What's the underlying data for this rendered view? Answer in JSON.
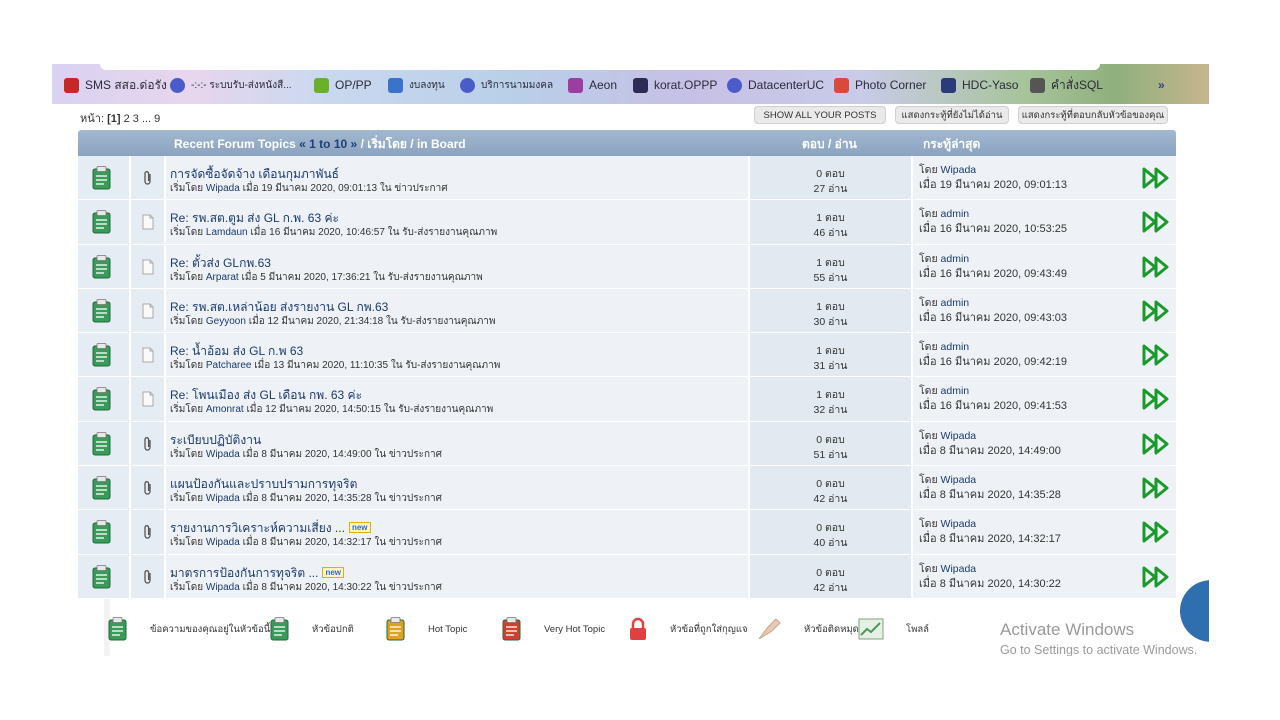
{
  "bookmarks": [
    {
      "label": "SMS สสอ.ด่อรัง",
      "icon": "bookmark-red-icon",
      "color": "#c62828"
    },
    {
      "label": "-:-:- ระบบรับ-ส่งหนังสื...",
      "icon": "globe-icon",
      "color": "#4a5cc9"
    },
    {
      "label": "OP/PP",
      "icon": "op-logo-icon",
      "color": "#6bb02b"
    },
    {
      "label": "งบลงทุน",
      "icon": "network-icon",
      "color": "#3a73c9"
    },
    {
      "label": "บริการนามมงคล",
      "icon": "globe-icon",
      "color": "#4a5cc9"
    },
    {
      "label": "Aeon",
      "icon": "aeon-icon",
      "color": "#9c3ea0"
    },
    {
      "label": "korat.OPPP",
      "icon": "b-logo-icon",
      "color": "#2b2b55"
    },
    {
      "label": "DatacenterUC",
      "icon": "globe-icon",
      "color": "#4a5cc9"
    },
    {
      "label": "Photo Corner",
      "icon": "photo-icon",
      "color": "#d84a3a"
    },
    {
      "label": "HDC-Yaso",
      "icon": "hdc-icon",
      "color": "#2a3a7a"
    },
    {
      "label": "คำสั่งSQL",
      "icon": "folder-icon",
      "color": "#555555"
    }
  ],
  "bookmarks_more": "»",
  "pager": {
    "label": "หน้า:",
    "current": "[1]",
    "rest": "2 3 ... 9"
  },
  "top_buttons": {
    "show_all": "SHOW ALL YOUR POSTS",
    "unread": "แสดงกระทู้ที่ยังไม่ได้อ่าน",
    "replies": "แสดงกระทู้ที่ตอบกลับหัวข้อของคุณ"
  },
  "header": {
    "title": "Recent Forum Topics",
    "range_open": "«",
    "range": "1 to 10",
    "range_close": "»",
    "rest": "/ เริ่มโดย / in Board",
    "replies_views": "ตอบ / อ่าน",
    "last_post": "กระทู้ล่าสุด"
  },
  "labels": {
    "started_by": "เริ่มโดย",
    "on": "เมื่อ",
    "in": "ใน",
    "by": "โดย",
    "new": "new"
  },
  "topics": [
    {
      "title": "การจัดซื้อจัดจ้าง เดือนกุมภาพันธ์",
      "new": false,
      "attachment": true,
      "author": "Wipada",
      "date": "19 มีนาคม 2020, 09:01:13",
      "board": "ข่าวประกาศ",
      "replies": "0 ตอบ",
      "views": "27 อ่าน",
      "last_by": "Wipada",
      "last_date": "19 มีนาคม 2020, 09:01:13"
    },
    {
      "title": "Re: รพ.สต.ตูม ส่ง GL ก.พ. 63 ค่ะ",
      "new": false,
      "attachment": false,
      "author": "Lamdaun",
      "date": "16 มีนาคม 2020, 10:46:57",
      "board": "รับ-ส่งรายงานคุณภาพ",
      "replies": "1 ตอบ",
      "views": "46 อ่าน",
      "last_by": "admin",
      "last_date": "16 มีนาคม 2020, 10:53:25"
    },
    {
      "title": "Re: ตั้วส่ง GLกพ.63",
      "new": false,
      "attachment": false,
      "author": "Arparat",
      "date": "5 มีนาคม 2020, 17:36:21",
      "board": "รับ-ส่งรายงานคุณภาพ",
      "replies": "1 ตอบ",
      "views": "55 อ่าน",
      "last_by": "admin",
      "last_date": "16 มีนาคม 2020, 09:43:49"
    },
    {
      "title": "Re: รพ.สต.เหล่าน้อย ส่งรายงาน GL กพ.63",
      "new": false,
      "attachment": false,
      "author": "Geyyoon",
      "date": "12 มีนาคม 2020, 21:34:18",
      "board": "รับ-ส่งรายงานคุณภาพ",
      "replies": "1 ตอบ",
      "views": "30 อ่าน",
      "last_by": "admin",
      "last_date": "16 มีนาคม 2020, 09:43:03"
    },
    {
      "title": "Re: น้ำอ้อม ส่ง GL ก.พ 63",
      "new": false,
      "attachment": false,
      "author": "Patcharee",
      "date": "13 มีนาคม 2020, 11:10:35",
      "board": "รับ-ส่งรายงานคุณภาพ",
      "replies": "1 ตอบ",
      "views": "31 อ่าน",
      "last_by": "admin",
      "last_date": "16 มีนาคม 2020, 09:42:19"
    },
    {
      "title": "Re: โพนเมือง ส่ง GL เดือน กพ. 63 ค่ะ",
      "new": false,
      "attachment": false,
      "author": "Amonrat",
      "date": "12 มีนาคม 2020, 14:50:15",
      "board": "รับ-ส่งรายงานคุณภาพ",
      "replies": "1 ตอบ",
      "views": "32 อ่าน",
      "last_by": "admin",
      "last_date": "16 มีนาคม 2020, 09:41:53"
    },
    {
      "title": "ระเบียบปฏิบัติงาน",
      "new": false,
      "attachment": true,
      "author": "Wipada",
      "date": "8 มีนาคม 2020, 14:49:00",
      "board": "ข่าวประกาศ",
      "replies": "0 ตอบ",
      "views": "51 อ่าน",
      "last_by": "Wipada",
      "last_date": "8 มีนาคม 2020, 14:49:00"
    },
    {
      "title": "แผนป้องกันและปราบปรามการทุจริต",
      "new": false,
      "attachment": true,
      "author": "Wipada",
      "date": "8 มีนาคม 2020, 14:35:28",
      "board": "ข่าวประกาศ",
      "replies": "0 ตอบ",
      "views": "42 อ่าน",
      "last_by": "Wipada",
      "last_date": "8 มีนาคม 2020, 14:35:28"
    },
    {
      "title": "รายงานการวิเคราะห์ความเสี่ยง ...",
      "new": true,
      "attachment": true,
      "author": "Wipada",
      "date": "8 มีนาคม 2020, 14:32:17",
      "board": "ข่าวประกาศ",
      "replies": "0 ตอบ",
      "views": "40 อ่าน",
      "last_by": "Wipada",
      "last_date": "8 มีนาคม 2020, 14:32:17"
    },
    {
      "title": "มาตรการป้องกันการทุจริต ...",
      "new": true,
      "attachment": true,
      "author": "Wipada",
      "date": "8 มีนาคม 2020, 14:30:22",
      "board": "ข่าวประกาศ",
      "replies": "0 ตอบ",
      "views": "42 อ่าน",
      "last_by": "Wipada",
      "last_date": "8 มีนาคม 2020, 14:30:22"
    }
  ],
  "legend": [
    {
      "label": "ข้อความของคุณอยู่ในหัวข้อนี้",
      "icon": "my-topic-icon",
      "color": "#3a9a5a"
    },
    {
      "label": "หัวข้อปกติ",
      "icon": "normal-topic-icon",
      "color": "#3a9a5a"
    },
    {
      "label": "Hot Topic",
      "icon": "hot-topic-icon",
      "color": "#e0a020"
    },
    {
      "label": "Very Hot Topic",
      "icon": "very-hot-topic-icon",
      "color": "#d04030"
    },
    {
      "label": "หัวข้อที่ถูกใส่กุญแจ",
      "icon": "locked-topic-icon",
      "color": "#e04040"
    },
    {
      "label": "หัวข้อติดหมุด",
      "icon": "pinned-topic-icon",
      "color": "#e8c8b0"
    },
    {
      "label": "โพลล์",
      "icon": "poll-icon",
      "color": "#4a9a5a"
    }
  ],
  "watermark": {
    "line1": "Activate Windows",
    "line2": "Go to Settings to activate Windows."
  },
  "colors": {
    "header_bg": "#8aa3c0",
    "link": "#1b3a6e",
    "play": "#1a9a2a"
  }
}
